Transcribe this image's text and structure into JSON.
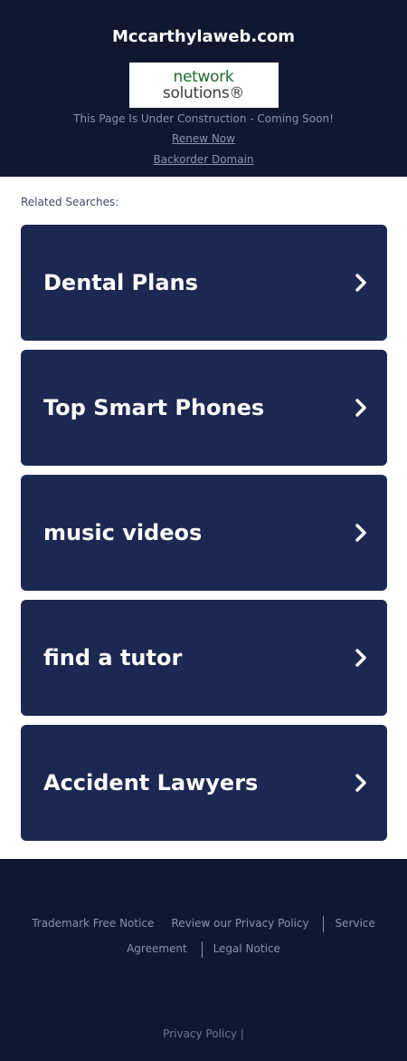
{
  "header": {
    "domain": "Mccarthylaweb.com",
    "logo_line1": "network",
    "logo_line2": "solutions®",
    "construction": "This Page Is Under Construction - Coming Soon!",
    "renew": "Renew Now",
    "backorder": "Backorder Domain"
  },
  "main": {
    "related_label": "Related Searches:",
    "cards": [
      {
        "label": "Dental Plans"
      },
      {
        "label": "Top Smart Phones"
      },
      {
        "label": "music videos"
      },
      {
        "label": "find a tutor"
      },
      {
        "label": "Accident Lawyers"
      }
    ]
  },
  "footer": {
    "trademark": "Trademark Free Notice",
    "privacy_review": "Review our Privacy Policy",
    "service": "Service Agreement",
    "legal": "Legal Notice",
    "privacy_policy": "Privacy Policy |"
  },
  "colors": {
    "dark_bg": "#101830",
    "card_bg": "#1b2851",
    "muted_text": "#8a93a8",
    "logo_green": "#1d6b2a"
  },
  "icons": {
    "card_arrow": "chevron-right-icon"
  }
}
